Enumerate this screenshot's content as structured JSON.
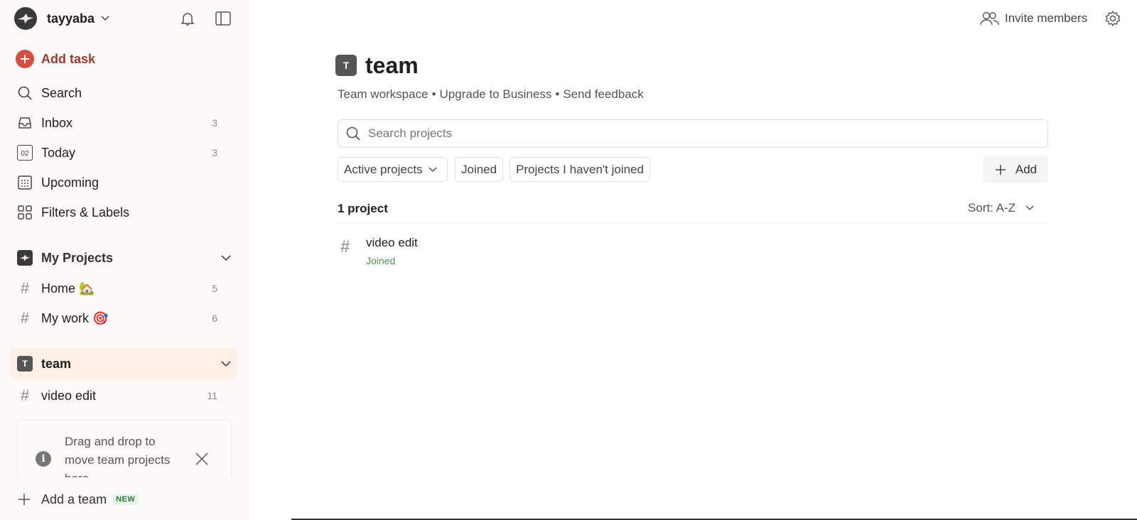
{
  "sidebar": {
    "user_name": "tayyaba",
    "add_task_label": "Add task",
    "nav": [
      {
        "label": "Search",
        "count": ""
      },
      {
        "label": "Inbox",
        "count": "3"
      },
      {
        "label": "Today",
        "count": "3"
      },
      {
        "label": "Upcoming",
        "count": ""
      },
      {
        "label": "Filters & Labels",
        "count": ""
      }
    ],
    "today_day": "02",
    "my_projects_label": "My Projects",
    "my_projects": [
      {
        "label": "Home 🏡",
        "count": "5"
      },
      {
        "label": "My work 🎯",
        "count": "6"
      }
    ],
    "team_label": "team",
    "team_initial": "T",
    "team_projects": [
      {
        "label": "video edit",
        "count": "11"
      }
    ],
    "tip_text": "Drag and drop to move team projects here",
    "add_team_label": "Add a team",
    "new_badge": "NEW"
  },
  "header": {
    "invite_label": "Invite members"
  },
  "workspace": {
    "initial": "T",
    "title": "team",
    "meta_workspace": "Team workspace",
    "meta_upgrade": "Upgrade to Business",
    "meta_feedback": "Send feedback",
    "separator": "•",
    "search_placeholder": "Search projects",
    "filters": {
      "active": "Active projects",
      "joined": "Joined",
      "not_joined": "Projects I haven't joined"
    },
    "add_label": "Add",
    "project_count": "1 project",
    "sort_label": "Sort: A-Z",
    "projects": [
      {
        "name": "video edit",
        "status": "Joined"
      }
    ]
  },
  "colors": {
    "accent": "#dc4c3e",
    "sidebar_bg": "#fcfaf8",
    "active_bg": "#ffefe5",
    "joined_green": "#4a9a4a"
  },
  "icons": [
    "bell-icon",
    "sidebar-toggle-icon",
    "search-icon",
    "inbox-icon",
    "calendar-icon",
    "upcoming-icon",
    "filters-icon",
    "chevron-down-icon",
    "info-icon",
    "close-icon",
    "plus-icon",
    "people-icon",
    "gear-icon",
    "hash-icon"
  ]
}
